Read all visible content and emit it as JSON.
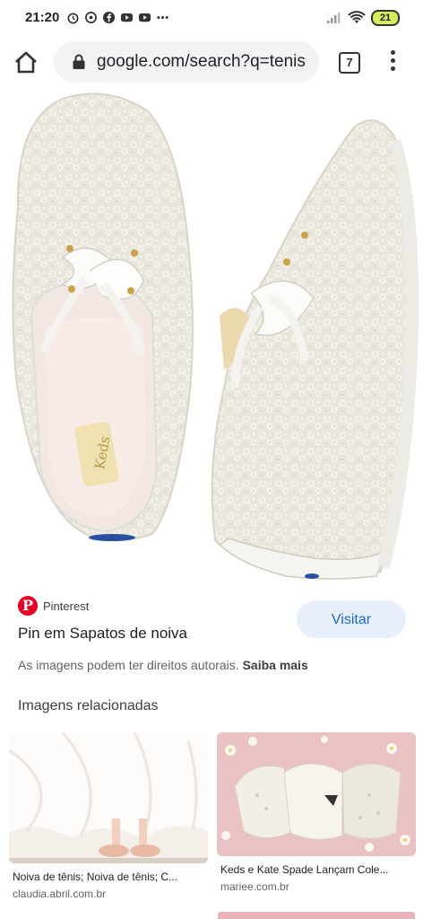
{
  "status_bar": {
    "time": "21:20",
    "battery": "21"
  },
  "browser": {
    "url": "google.com/search?q=tenis",
    "tab_count": "7"
  },
  "result": {
    "source": "Pinterest",
    "title": "Pin em Sapatos de noiva",
    "visit_label": "Visitar",
    "rights_text": "As imagens podem ter direitos autorais.",
    "learn_more": "Saiba mais",
    "image_brand": "Keds"
  },
  "related": {
    "heading": "Imagens relacionadas",
    "items": [
      {
        "caption": "Noiva de tênis; Noiva de tênis; C...",
        "domain": "claudia.abril.com.br"
      },
      {
        "caption": "Keds e Kate Spade Lançam Cole...",
        "domain": "mariee.com.br"
      }
    ]
  },
  "colors": {
    "pinterest_red": "#e60023",
    "visit_bg": "#e8f0fe",
    "visit_text": "#1967d2",
    "battery": "#d6eb5e"
  }
}
